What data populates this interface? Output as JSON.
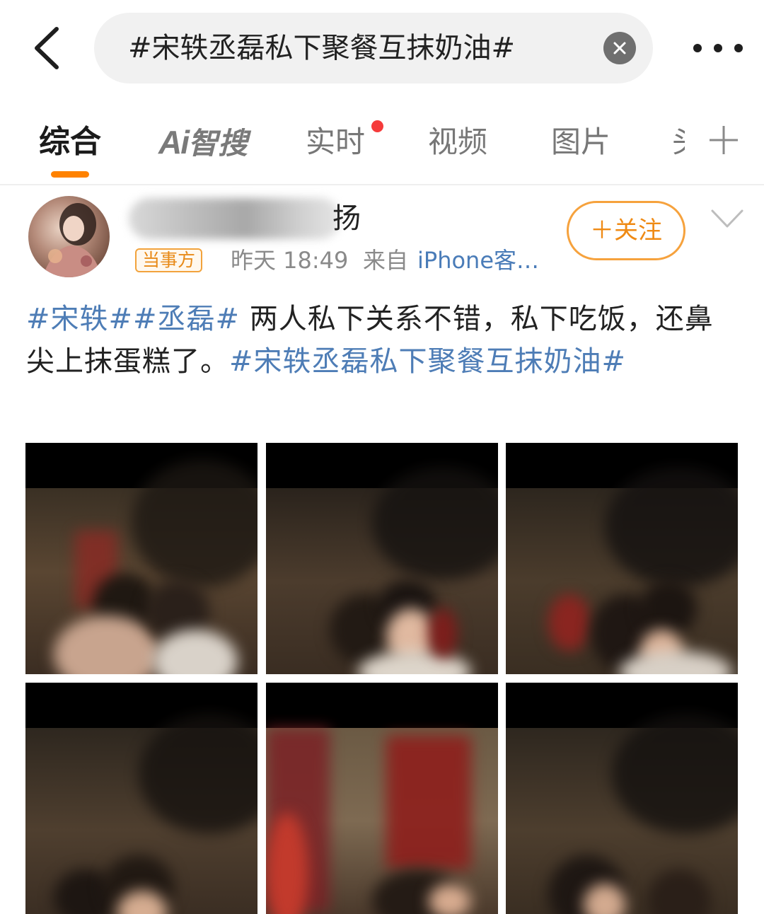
{
  "topbar": {
    "search_query": "#宋轶丞磊私下聚餐互抹奶油#"
  },
  "tabs": [
    {
      "label": "综合",
      "active": true
    },
    {
      "label": "Ai智搜",
      "mark": "Ai",
      "text": "智搜"
    },
    {
      "label": "实时",
      "has_notification_dot": true
    },
    {
      "label": "视频"
    },
    {
      "label": "图片"
    },
    {
      "label": "头",
      "truncated": true
    }
  ],
  "post": {
    "author_suffix": "扬",
    "role_badge": "当事方",
    "time": "昨天 18:49",
    "from_label": "来自",
    "source": "iPhone客…",
    "follow_label": "＋关注",
    "text": {
      "tag1": "#宋轶#",
      "tag2": "#丞磊#",
      "body": " 两人私下关系不错，私下吃饭，还鼻尖上抹蛋糕了。",
      "tag3": "#宋轶丞磊私下聚餐互抹奶油#"
    },
    "image_count": 6
  },
  "colors": {
    "accent": "#ff8200",
    "link": "#4e7db6",
    "notification": "#f53b3b",
    "follow": "#ef8a14"
  }
}
